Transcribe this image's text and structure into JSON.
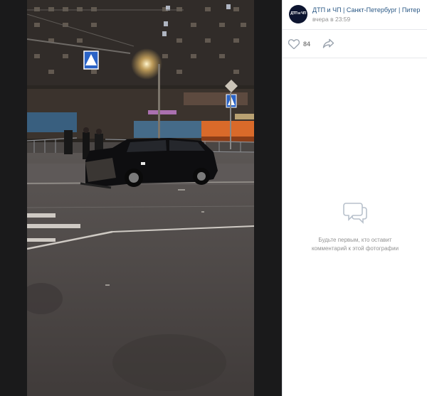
{
  "post": {
    "group_name": "ДТП и ЧП | Санкт-Петербург | Питер",
    "avatar_title": "ДТП и ЧП",
    "time": "вчера в 23:59",
    "likes": "84"
  },
  "comments": {
    "empty_line1": "Будьте первым, кто оставит",
    "empty_line2": "комментарий к этой фотографии"
  },
  "icons": {
    "like": "heart-icon",
    "share": "share-icon",
    "comments_empty": "chat-bubble-icon"
  }
}
